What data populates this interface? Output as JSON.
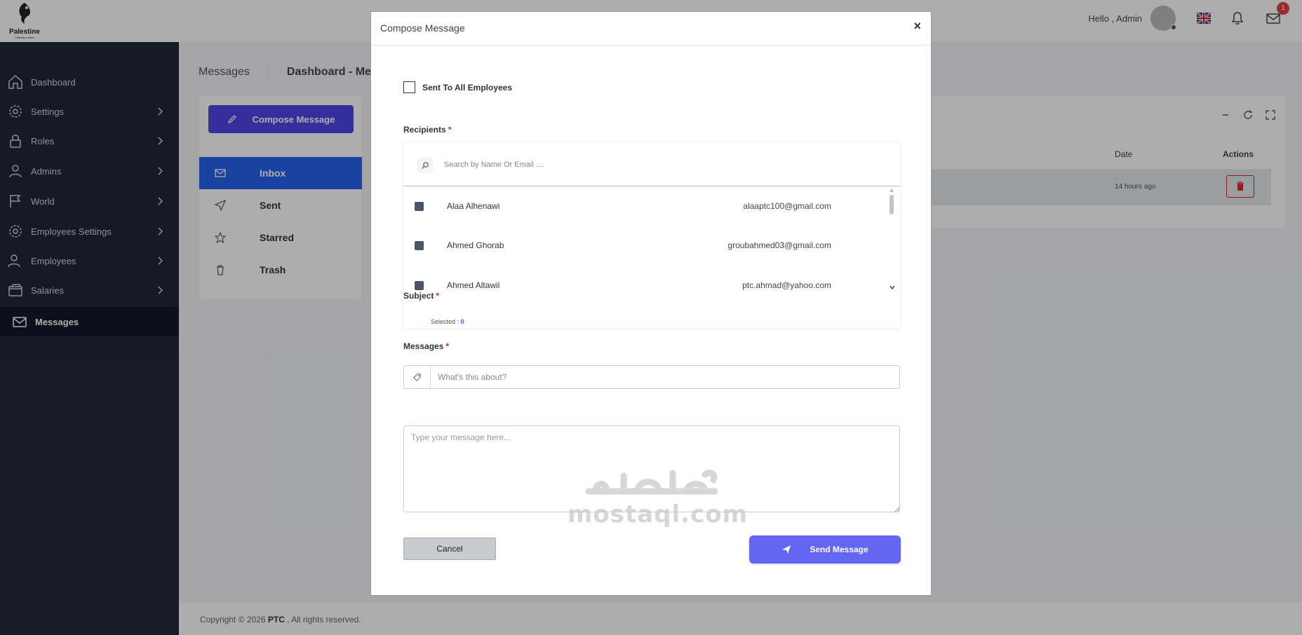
{
  "brand": {
    "logo_text": "Palestine",
    "logo_sub": "Training Centre"
  },
  "topbar": {
    "greeting": "Hello ,  Admin",
    "mail_badge": "1"
  },
  "sidebar": {
    "items": [
      {
        "label": "Dashboard",
        "icon": "home-icon"
      },
      {
        "label": "Settings",
        "icon": "gear-icon"
      },
      {
        "label": "Roles",
        "icon": "lock-icon"
      },
      {
        "label": "Admins",
        "icon": "user-icon"
      },
      {
        "label": "World",
        "icon": "flag-icon"
      },
      {
        "label": "Employees Settings",
        "icon": "gear-icon"
      },
      {
        "label": "Employees",
        "icon": "users-icon"
      },
      {
        "label": "Salaries",
        "icon": "wallet-icon"
      },
      {
        "label": "Messages",
        "icon": "mail-icon"
      }
    ]
  },
  "breadcrumb": {
    "page": "Messages",
    "crumb": "Dashboard  -  Mess"
  },
  "mail_nav": {
    "compose_label": "Compose Message",
    "items": [
      {
        "label": "Inbox"
      },
      {
        "label": "Sent"
      },
      {
        "label": "Starred"
      },
      {
        "label": "Trash"
      }
    ]
  },
  "inbox": {
    "columns": {
      "date": "Date",
      "actions": "Actions"
    },
    "rows": [
      {
        "date": "14 hours ago"
      }
    ]
  },
  "footer": {
    "prefix": "Copyright © 2026 ",
    "brand": "PTC",
    "suffix": " , All rights reserved."
  },
  "modal": {
    "title": "Compose Message",
    "close": "×",
    "send_all_label": "Sent To All Employees",
    "recipients_label": "Recipients",
    "required_mark": "*",
    "search_placeholder": "Search by Name Or Email ....",
    "recipients": [
      {
        "name": "Alaa Alhenawi",
        "email": "alaaptc100@gmail.com"
      },
      {
        "name": "Ahmed Ghorab",
        "email": "groubahmed03@gmail.com"
      },
      {
        "name": "Ahmed Altawil",
        "email": "ptc.ahmad@yahoo.com"
      }
    ],
    "selected_label": "Selected : ",
    "selected_count": "0",
    "subject_label": "Subject",
    "subject_placeholder": "What's this about?",
    "messages_label": "Messages",
    "message_placeholder": "Type your message here...",
    "cancel_label": "Cancel",
    "send_label": "Send Message"
  },
  "watermark": {
    "text": "mostaql.com"
  },
  "colors": {
    "accent": "#4f46e5",
    "sidebar_bg": "#1f2937",
    "inbox_active": "#2563eb",
    "danger": "#dc2626"
  }
}
